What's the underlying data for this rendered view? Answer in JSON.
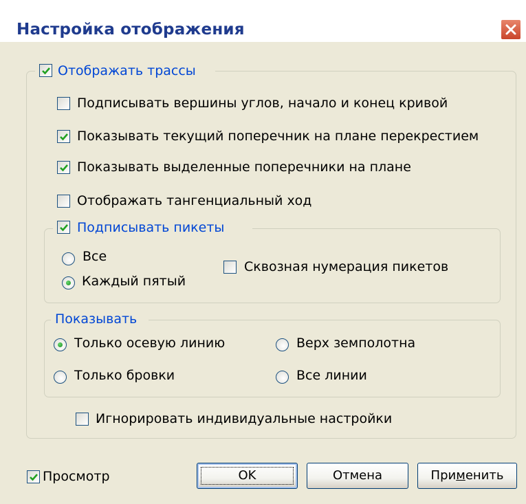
{
  "window": {
    "title": "Настройка отображения"
  },
  "show_routes": {
    "label": "Отображать трассы",
    "checked": true
  },
  "options": [
    {
      "label": "Подписывать вершины углов, начало и конец кривой",
      "checked": false
    },
    {
      "label": "Показывать текущий поперечник на плане перекрестием",
      "checked": true
    },
    {
      "label": "Показывать выделенные поперечники на плане",
      "checked": true
    },
    {
      "label": "Отображать тангенциальный ход",
      "checked": false
    }
  ],
  "pickets": {
    "label": "Подписывать пикеты",
    "checked": true,
    "radio_all": "Все",
    "radio_every_fifth": "Каждый пятый",
    "selected": "every_fifth",
    "through_numbering": {
      "label": "Сквозная нумерация пикетов",
      "checked": false
    }
  },
  "show": {
    "legend": "Показывать",
    "axis_only": "Только осевую линию",
    "subgrade_top": "Верх земполотна",
    "edges_only": "Только бровки",
    "all_lines": "Все линии",
    "selected": "axis_only"
  },
  "ignore_individual": {
    "label": "Игнорировать индивидуальные настройки",
    "checked": false
  },
  "footer": {
    "preview": {
      "label": "Просмотр",
      "checked": true
    },
    "ok": "OK",
    "cancel": "Отмена",
    "apply_prefix": "При",
    "apply_hotkey": "м",
    "apply_suffix": "енить"
  },
  "colors": {
    "title": "#1f3b8e",
    "group_label": "#0046d5",
    "close_button": "#c9452b",
    "check": "#21a121"
  }
}
